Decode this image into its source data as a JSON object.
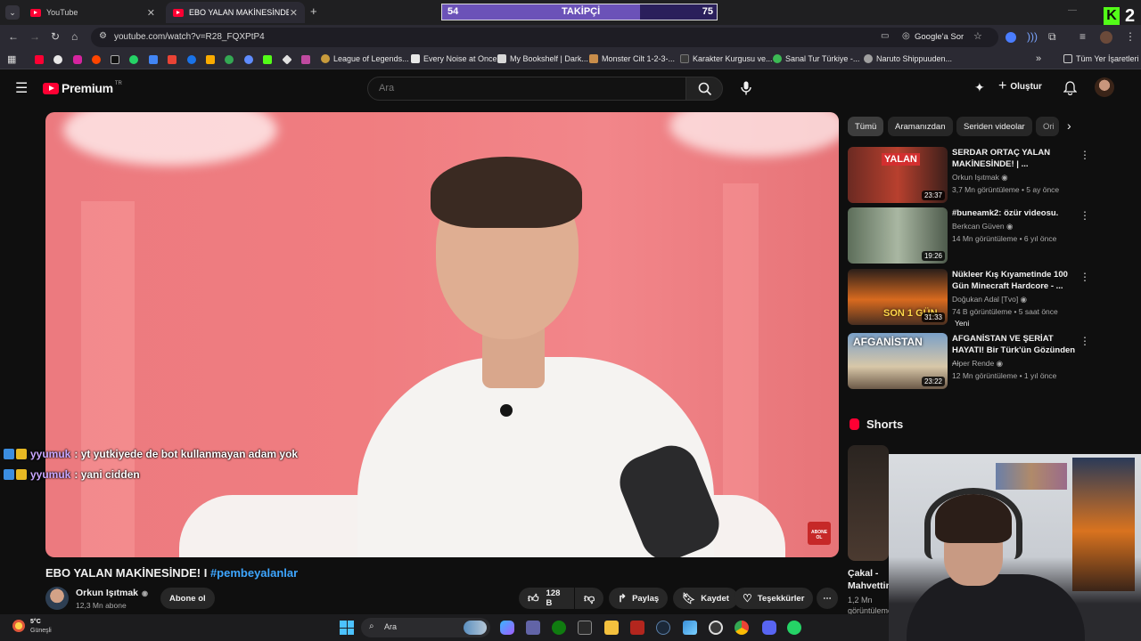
{
  "tabs": [
    {
      "label": "YouTube",
      "active": false
    },
    {
      "label": "EBO YALAN MAKİNESİNDE! I #p",
      "active": true
    }
  ],
  "follower_goal": {
    "label": "TAKİPÇİ",
    "current": "54",
    "target": "75",
    "progress": 0.72
  },
  "corner_badge": {
    "letter": "K",
    "count": "2"
  },
  "address": {
    "url": "youtube.com/watch?v=R28_FQXPtP4",
    "ask_google": "Google'a Sor"
  },
  "bookmarks": {
    "items": [
      "League of Legends...",
      "Every Noise at Once",
      "My Bookshelf | Dark...",
      "Monster Cilt 1-2-3-...",
      "Karakter Kurgusu ve...",
      "Sanal Tur Türkiye -...",
      "Naruto Shippuuden..."
    ],
    "all_label": "Tüm Yer İşaretleri"
  },
  "yt_header": {
    "logo": "Premium",
    "region": "TR",
    "search_placeholder": "Ara",
    "create_label": "Oluştur"
  },
  "chips": [
    "Tümü",
    "Aramanızdan",
    "Seriden videolar",
    "Ori"
  ],
  "recommendations": [
    {
      "title": "SERDAR ORTAÇ YALAN MAKİNESİNDE! | ...",
      "channel": "Orkun Işıtmak",
      "meta": "3,7 Mn görüntüleme • 5 ay önce",
      "duration": "23:37",
      "thumb_text": "YALAN",
      "new": ""
    },
    {
      "title": "#buneamk2: özür videosu.",
      "channel": "Berkcan Güven",
      "meta": "14 Mn görüntüleme • 6 yıl önce",
      "duration": "19:26",
      "thumb_text": "",
      "new": ""
    },
    {
      "title": "Nükleer Kış Kıyametinde 100 Gün Minecraft Hardcore - ...",
      "channel": "Doğukan Adal [Tvo]",
      "meta": "74 B görüntüleme • 5 saat önce",
      "duration": "31:33",
      "thumb_text": "SON 1 GÜN",
      "new": "Yeni"
    },
    {
      "title": "AFGANİSTAN VE ŞERİAT HAYATI! Bir Türk'ün Gözünden ...",
      "channel": "Alper Rende",
      "meta": "12 Mn görüntüleme • 1 yıl önce",
      "duration": "23:22",
      "thumb_text": "AFGANİSTAN",
      "new": ""
    }
  ],
  "shorts": {
    "heading": "Shorts",
    "first_title": "Çakal - Mahvettin",
    "first_views": "1,2 Mn",
    "first_views_tail": "görüntüleme"
  },
  "chat": [
    {
      "user": "yyumuk",
      "message": ": yt yutkiyede de bot kullanmayan adam yok"
    },
    {
      "user": "yyumuk",
      "message": ": yani cidden"
    }
  ],
  "video": {
    "title": "EBO YALAN MAKİNESİNDE! I",
    "hashtag": "#pembeyalanlar",
    "subscribe_overlay": "ABONE OL",
    "channel_name": "Orkun Işıtmak",
    "subscribers": "12,3 Mn abone",
    "subscribe_label": "Abone ol",
    "likes": "128 B",
    "share_label": "Paylaş",
    "save_label": "Kaydet",
    "thanks_label": "Teşekkürler"
  },
  "taskbar": {
    "weather_temp": "5°C",
    "weather_desc": "Güneşli",
    "search_placeholder": "Ara"
  },
  "colors": {
    "accent_red": "#ff0033",
    "link_blue": "#3ea6ff",
    "goal_purple": "#6b52b8"
  }
}
